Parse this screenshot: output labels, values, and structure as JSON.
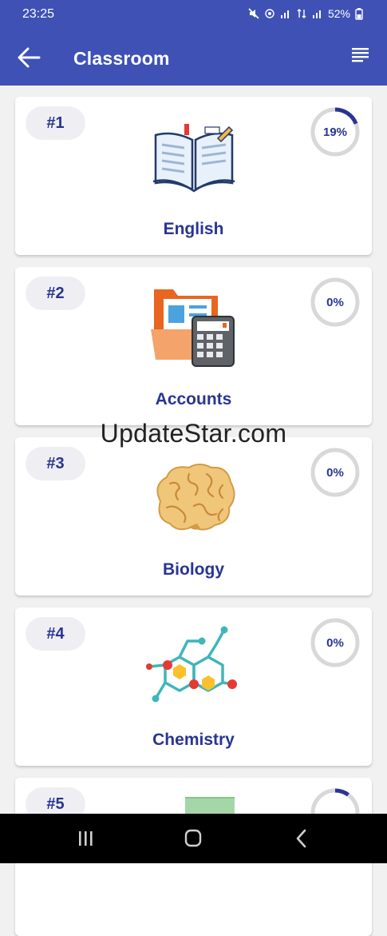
{
  "status_bar": {
    "time": "23:25",
    "battery": "52%"
  },
  "toolbar": {
    "title": "Classroom"
  },
  "subjects": [
    {
      "rank": "#1",
      "name": "English",
      "progress_label": "19%",
      "progress": 0.19
    },
    {
      "rank": "#2",
      "name": "Accounts",
      "progress_label": "0%",
      "progress": 0
    },
    {
      "rank": "#3",
      "name": "Biology",
      "progress_label": "0%",
      "progress": 0
    },
    {
      "rank": "#4",
      "name": "Chemistry",
      "progress_label": "0%",
      "progress": 0
    },
    {
      "rank": "#5",
      "name": "",
      "progress_label": "",
      "progress": 0.1
    }
  ],
  "watermark": "UpdateStar.com",
  "colors": {
    "primary": "#3f51b5",
    "accent_text": "#283593",
    "ring_track": "#d8d8d8"
  },
  "icons": {
    "back": "arrow-left-icon",
    "menu": "menu-lines-icon",
    "english": "open-book-icon",
    "accounts": "folder-calculator-icon",
    "biology": "brain-icon",
    "chemistry": "molecule-icon"
  }
}
